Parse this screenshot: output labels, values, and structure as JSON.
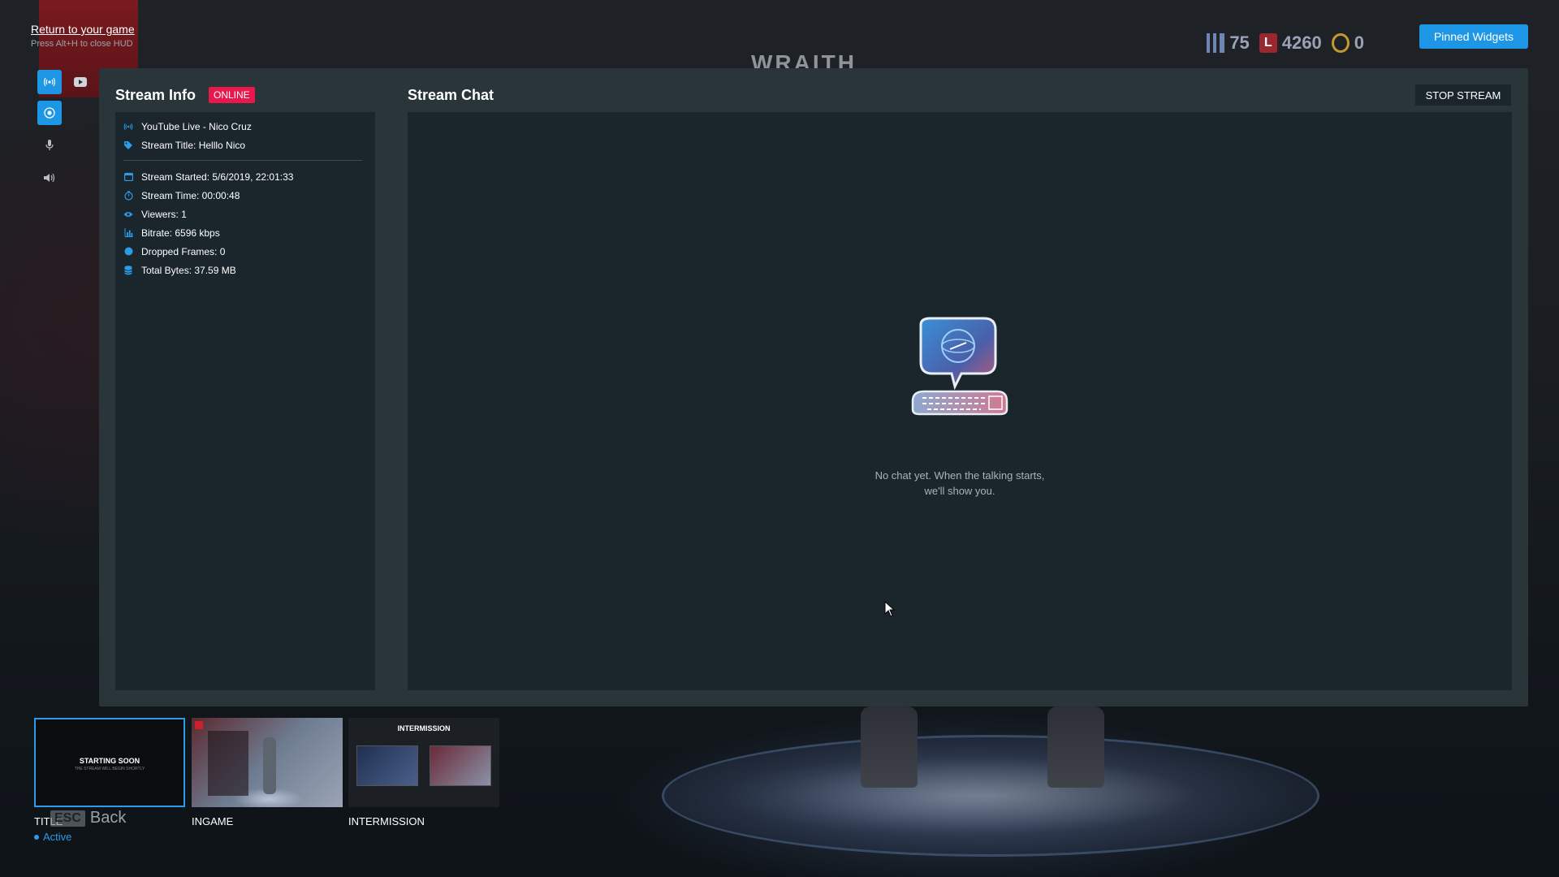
{
  "background": {
    "hero_name": "WRAITH"
  },
  "hud": {
    "return_link": "Return to your game",
    "hint": "Press Alt+H to close HUD"
  },
  "top_stats": [
    {
      "icon": "level-bars-icon",
      "value": "75"
    },
    {
      "icon": "legend-tokens-icon",
      "value": "4260"
    },
    {
      "icon": "coin-icon",
      "value": "0"
    }
  ],
  "pinned_widgets_label": "Pinned Widgets",
  "rail": {
    "tabs": [
      {
        "icon": "broadcast-icon",
        "active": true
      },
      {
        "icon": "youtube-icon",
        "active": false
      }
    ],
    "items": [
      {
        "icon": "record-icon",
        "active": true
      },
      {
        "icon": "microphone-icon",
        "active": false
      },
      {
        "icon": "speaker-icon",
        "active": false
      }
    ]
  },
  "stream_info": {
    "title": "Stream Info",
    "status_badge": "ONLINE",
    "top_rows": [
      {
        "icon": "broadcast-icon",
        "text": "YouTube Live - Nico Cruz"
      },
      {
        "icon": "tag-icon",
        "text": "Stream Title: Helllo Nico"
      }
    ],
    "stat_rows": [
      {
        "icon": "calendar-icon",
        "text": "Stream Started: 5/6/2019, 22:01:33"
      },
      {
        "icon": "stopwatch-icon",
        "text": "Stream Time: 00:00:48"
      },
      {
        "icon": "eye-icon",
        "text": "Viewers: 1"
      },
      {
        "icon": "bar-chart-icon",
        "text": "Bitrate: 6596 kbps"
      },
      {
        "icon": "dot-icon",
        "text": "Dropped Frames: 0"
      },
      {
        "icon": "database-icon",
        "text": "Total Bytes: 37.59 MB"
      }
    ]
  },
  "stream_chat": {
    "title": "Stream Chat",
    "stop_label": "STOP STREAM",
    "empty_line1": "No chat yet. When the talking starts,",
    "empty_line2": "we'll show you."
  },
  "scenes": [
    {
      "label": "TITLE",
      "status": "Active",
      "thumb_title": "STARTING SOON",
      "thumb_sub": "THE STREAM WILL BEGIN SHORTLY"
    },
    {
      "label": "INGAME",
      "status": ""
    },
    {
      "label": "INTERMISSION",
      "status": "",
      "thumb_title": "INTERMISSION"
    }
  ],
  "esc_back": {
    "key": "ESC",
    "label": "Back"
  },
  "colors": {
    "accent": "#1e96e6",
    "online": "#e8174d",
    "panel": "#2a3539",
    "box": "#1a262c"
  }
}
